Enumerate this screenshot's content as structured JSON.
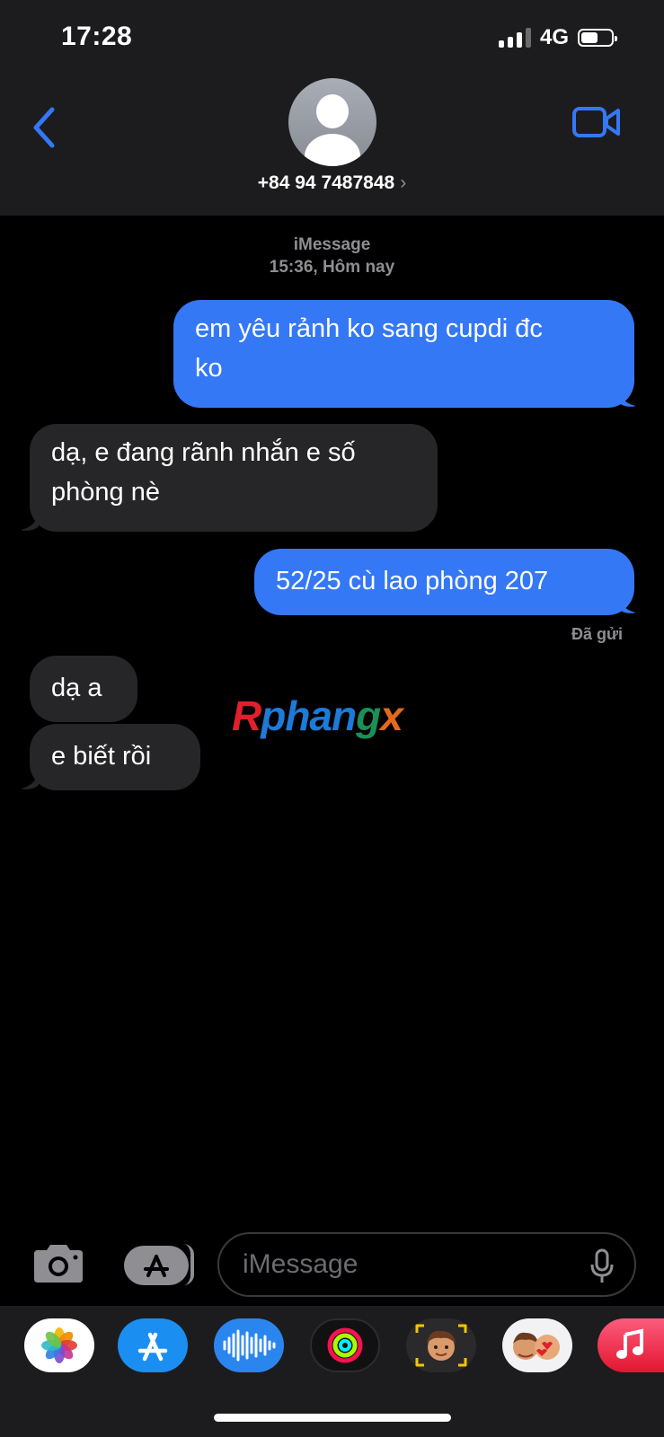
{
  "status_bar": {
    "time": "17:28",
    "network": "4G"
  },
  "header": {
    "contact": "+84 94 7487848",
    "chevron": "›"
  },
  "conversation": {
    "service": "iMessage",
    "timestamp": "15:36, Hôm nay",
    "messages": [
      {
        "from": "me",
        "text_lines": [
          "em yêu rảnh ko sang cupdi đc",
          "ko"
        ]
      },
      {
        "from": "them",
        "text_lines": [
          "dạ, e đang rãnh nhắn e số",
          "phòng nè"
        ]
      },
      {
        "from": "me",
        "text_lines": [
          "52/25 cù lao phòng 207"
        ]
      },
      {
        "from": "them",
        "text_lines": [
          "dạ a"
        ]
      },
      {
        "from": "them",
        "text_lines": [
          "e biết rồi"
        ]
      }
    ],
    "delivered_label": "Đã gửi"
  },
  "watermark": {
    "p1": "R",
    "p2": "phan",
    "p3": "g",
    "p4": "x"
  },
  "input": {
    "placeholder": "iMessage"
  },
  "app_drawer": [
    "photos-icon",
    "app-store-icon",
    "audio-message-icon",
    "activity-icon",
    "memoji-icon",
    "memoji-stickers-icon",
    "music-icon"
  ],
  "colors": {
    "bubble_out": "#3478f6",
    "bubble_in": "#262628",
    "accent": "#3478f6"
  }
}
